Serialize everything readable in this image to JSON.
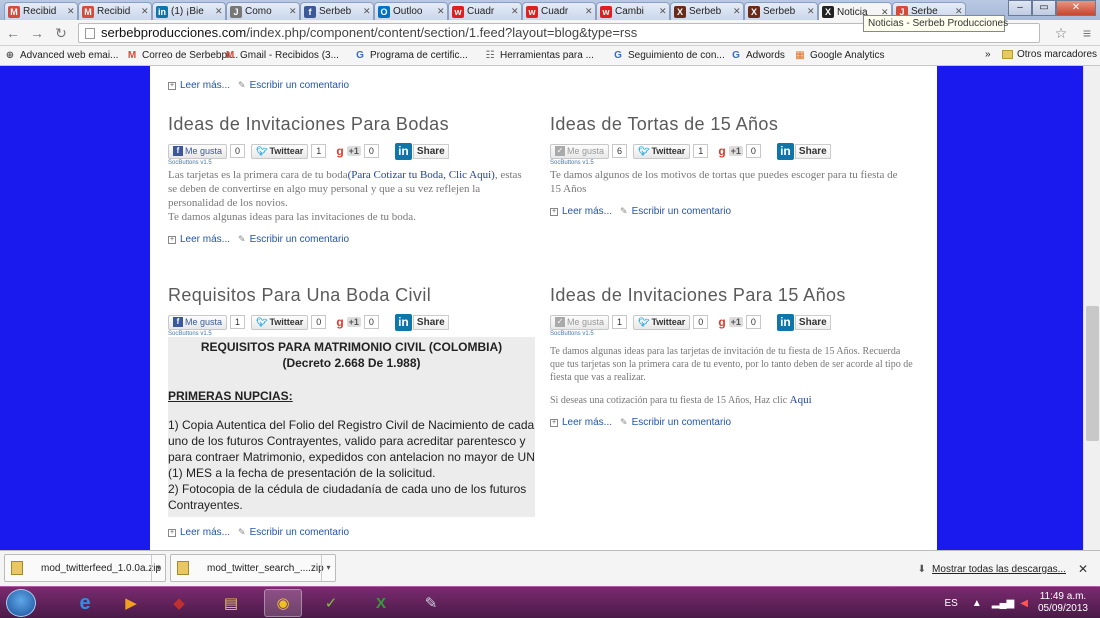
{
  "tabs": [
    {
      "title": "Recibid",
      "fav": "M",
      "color": "#d44b3b"
    },
    {
      "title": "Recibid",
      "fav": "M",
      "color": "#d44b3b"
    },
    {
      "title": "(1) ¡Bie",
      "fav": "in",
      "color": "#0e76a8"
    },
    {
      "title": "Como",
      "fav": "J",
      "color": "#777"
    },
    {
      "title": "Serbeb",
      "fav": "f",
      "color": "#3b5998"
    },
    {
      "title": "Outloo",
      "fav": "O",
      "color": "#0072c6"
    },
    {
      "title": "Cuadr",
      "fav": "w",
      "color": "#e02020"
    },
    {
      "title": "Cuadr",
      "fav": "w",
      "color": "#e02020"
    },
    {
      "title": "Cambi",
      "fav": "w",
      "color": "#e02020"
    },
    {
      "title": "Serbeb",
      "fav": "X",
      "color": "#6a2a1a"
    },
    {
      "title": "Serbeb",
      "fav": "X",
      "color": "#6a2a1a"
    },
    {
      "title": "Noticia",
      "fav": "X",
      "color": "#222"
    },
    {
      "title": "Serbe",
      "fav": "J",
      "color": "#d44b3b"
    }
  ],
  "tooltip": "Noticias - Serbeb Producciones",
  "url": {
    "host": "serbebproducciones.com",
    "path": "/index.php/component/content/section/1.feed?layout=blog&type=rss"
  },
  "bookmarks": [
    "Advanced web emai...",
    "Correo de Serbebpr...",
    "Gmail - Recibidos (3...",
    "Programa de certific...",
    "Herramientas para ...",
    "Seguimiento de con...",
    "Adwords",
    "Google Analytics"
  ],
  "bookmarks_more": "»",
  "other_bookmarks": "Otros marcadores",
  "labels": {
    "read_more": "Leer más...",
    "write_comment": "Escribir un comentario",
    "me_gusta": "Me gusta",
    "twittear": "Twittear",
    "plus_one": "+1",
    "share": "Share",
    "socver": "SocButtons v1.5"
  },
  "articles": {
    "a1": {
      "title": "Ideas de Invitaciones Para Bodas",
      "likes": "0",
      "tweets": "1",
      "plus": "0",
      "p1_a": "Las tarjetas es la primera cara de tu boda",
      "p1_link": "(Para Cotizar tu Boda, Clic Aqui)",
      "p1_b": ", estas se deben de convertirse en algo muy personal y que a su vez reflejen la personalidad de los novios.",
      "p2": "Te damos algunas ideas para las invitaciones de tu boda."
    },
    "a2": {
      "title": "Ideas de Tortas de 15 Años",
      "likes": "6",
      "tweets": "1",
      "plus": "0",
      "p1": "Te damos algunos de los motivos de tortas que puedes escoger para tu fiesta de 15 Años"
    },
    "a3": {
      "title": "Requisitos Para Una Boda Civil",
      "likes": "1",
      "tweets": "0",
      "plus": "0",
      "h1": "REQUISITOS PARA MATRIMONIO CIVIL (COLOMBIA)",
      "h2": "(Decreto 2.668 De 1.988)",
      "sub": "PRIMERAS NUPCIAS:",
      "t1": "1) Copia Autentica del Folio del Registro Civil de Nacimiento de cada uno de los futuros Contrayentes, valido para acreditar parentesco y para contraer Matrimonio, expedidos con antelacion no mayor de UN (1) MES a la fecha de presentación de la solicitud.",
      "t2": "2) Fotocopia de la cédula de ciudadanía de cada uno de los futuros Contrayentes."
    },
    "a4": {
      "title": "Ideas de Invitaciones Para 15 Años",
      "likes": "1",
      "tweets": "0",
      "plus": "0",
      "p1": "Te damos algunas ideas para las tarjetas de invitación de tu fiesta de 15 Años. Recuerda que tus tarjetas son la primera cara de tu evento, por lo tanto deben de ser acorde al tipo de fiesta que vas a realizar.",
      "p2": "Si deseas una cotización para tu fiesta de 15 Años, Haz clic ",
      "p2_link": "Aqui"
    }
  },
  "downloads": [
    "mod_twitterfeed_1.0.0a.zip",
    "mod_twitter_search_....zip"
  ],
  "show_all": "Mostrar todas las descargas...",
  "tray": {
    "lang": "ES",
    "time": "11:49 a.m.",
    "date": "05/09/2013"
  }
}
